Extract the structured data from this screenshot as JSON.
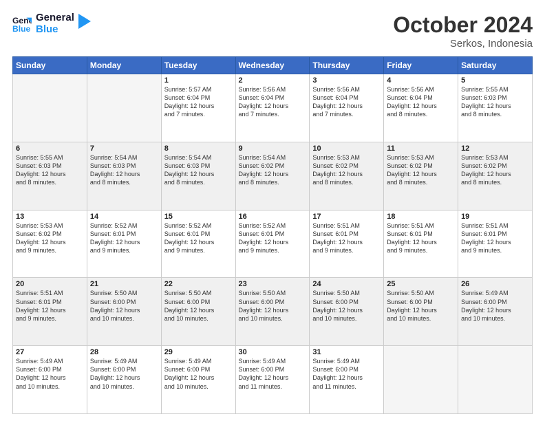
{
  "header": {
    "logo_line1": "General",
    "logo_line2": "Blue",
    "month": "October 2024",
    "location": "Serkos, Indonesia"
  },
  "weekdays": [
    "Sunday",
    "Monday",
    "Tuesday",
    "Wednesday",
    "Thursday",
    "Friday",
    "Saturday"
  ],
  "weeks": [
    [
      {
        "num": "",
        "info": ""
      },
      {
        "num": "",
        "info": ""
      },
      {
        "num": "1",
        "info": "Sunrise: 5:57 AM\nSunset: 6:04 PM\nDaylight: 12 hours\nand 7 minutes."
      },
      {
        "num": "2",
        "info": "Sunrise: 5:56 AM\nSunset: 6:04 PM\nDaylight: 12 hours\nand 7 minutes."
      },
      {
        "num": "3",
        "info": "Sunrise: 5:56 AM\nSunset: 6:04 PM\nDaylight: 12 hours\nand 7 minutes."
      },
      {
        "num": "4",
        "info": "Sunrise: 5:56 AM\nSunset: 6:04 PM\nDaylight: 12 hours\nand 8 minutes."
      },
      {
        "num": "5",
        "info": "Sunrise: 5:55 AM\nSunset: 6:03 PM\nDaylight: 12 hours\nand 8 minutes."
      }
    ],
    [
      {
        "num": "6",
        "info": "Sunrise: 5:55 AM\nSunset: 6:03 PM\nDaylight: 12 hours\nand 8 minutes."
      },
      {
        "num": "7",
        "info": "Sunrise: 5:54 AM\nSunset: 6:03 PM\nDaylight: 12 hours\nand 8 minutes."
      },
      {
        "num": "8",
        "info": "Sunrise: 5:54 AM\nSunset: 6:03 PM\nDaylight: 12 hours\nand 8 minutes."
      },
      {
        "num": "9",
        "info": "Sunrise: 5:54 AM\nSunset: 6:02 PM\nDaylight: 12 hours\nand 8 minutes."
      },
      {
        "num": "10",
        "info": "Sunrise: 5:53 AM\nSunset: 6:02 PM\nDaylight: 12 hours\nand 8 minutes."
      },
      {
        "num": "11",
        "info": "Sunrise: 5:53 AM\nSunset: 6:02 PM\nDaylight: 12 hours\nand 8 minutes."
      },
      {
        "num": "12",
        "info": "Sunrise: 5:53 AM\nSunset: 6:02 PM\nDaylight: 12 hours\nand 8 minutes."
      }
    ],
    [
      {
        "num": "13",
        "info": "Sunrise: 5:53 AM\nSunset: 6:02 PM\nDaylight: 12 hours\nand 9 minutes."
      },
      {
        "num": "14",
        "info": "Sunrise: 5:52 AM\nSunset: 6:01 PM\nDaylight: 12 hours\nand 9 minutes."
      },
      {
        "num": "15",
        "info": "Sunrise: 5:52 AM\nSunset: 6:01 PM\nDaylight: 12 hours\nand 9 minutes."
      },
      {
        "num": "16",
        "info": "Sunrise: 5:52 AM\nSunset: 6:01 PM\nDaylight: 12 hours\nand 9 minutes."
      },
      {
        "num": "17",
        "info": "Sunrise: 5:51 AM\nSunset: 6:01 PM\nDaylight: 12 hours\nand 9 minutes."
      },
      {
        "num": "18",
        "info": "Sunrise: 5:51 AM\nSunset: 6:01 PM\nDaylight: 12 hours\nand 9 minutes."
      },
      {
        "num": "19",
        "info": "Sunrise: 5:51 AM\nSunset: 6:01 PM\nDaylight: 12 hours\nand 9 minutes."
      }
    ],
    [
      {
        "num": "20",
        "info": "Sunrise: 5:51 AM\nSunset: 6:01 PM\nDaylight: 12 hours\nand 9 minutes."
      },
      {
        "num": "21",
        "info": "Sunrise: 5:50 AM\nSunset: 6:00 PM\nDaylight: 12 hours\nand 10 minutes."
      },
      {
        "num": "22",
        "info": "Sunrise: 5:50 AM\nSunset: 6:00 PM\nDaylight: 12 hours\nand 10 minutes."
      },
      {
        "num": "23",
        "info": "Sunrise: 5:50 AM\nSunset: 6:00 PM\nDaylight: 12 hours\nand 10 minutes."
      },
      {
        "num": "24",
        "info": "Sunrise: 5:50 AM\nSunset: 6:00 PM\nDaylight: 12 hours\nand 10 minutes."
      },
      {
        "num": "25",
        "info": "Sunrise: 5:50 AM\nSunset: 6:00 PM\nDaylight: 12 hours\nand 10 minutes."
      },
      {
        "num": "26",
        "info": "Sunrise: 5:49 AM\nSunset: 6:00 PM\nDaylight: 12 hours\nand 10 minutes."
      }
    ],
    [
      {
        "num": "27",
        "info": "Sunrise: 5:49 AM\nSunset: 6:00 PM\nDaylight: 12 hours\nand 10 minutes."
      },
      {
        "num": "28",
        "info": "Sunrise: 5:49 AM\nSunset: 6:00 PM\nDaylight: 12 hours\nand 10 minutes."
      },
      {
        "num": "29",
        "info": "Sunrise: 5:49 AM\nSunset: 6:00 PM\nDaylight: 12 hours\nand 10 minutes."
      },
      {
        "num": "30",
        "info": "Sunrise: 5:49 AM\nSunset: 6:00 PM\nDaylight: 12 hours\nand 11 minutes."
      },
      {
        "num": "31",
        "info": "Sunrise: 5:49 AM\nSunset: 6:00 PM\nDaylight: 12 hours\nand 11 minutes."
      },
      {
        "num": "",
        "info": ""
      },
      {
        "num": "",
        "info": ""
      }
    ]
  ],
  "row_styles": [
    "white",
    "light",
    "white",
    "light",
    "white"
  ]
}
